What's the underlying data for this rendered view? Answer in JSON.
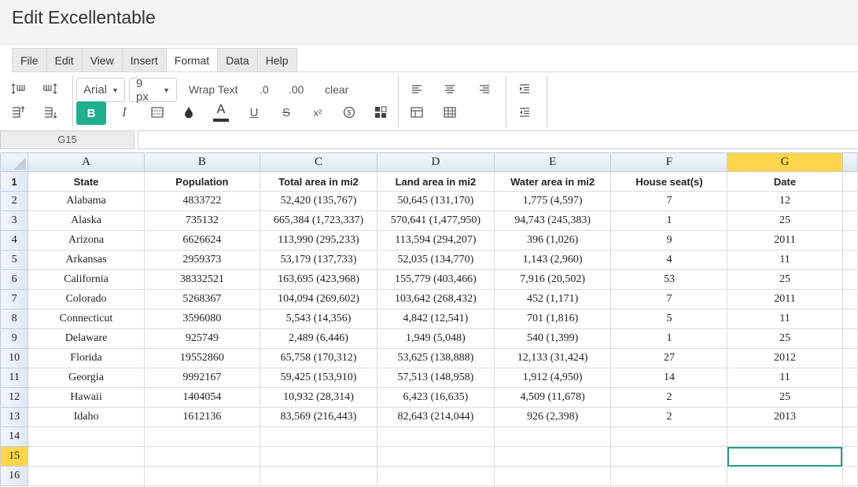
{
  "app": {
    "title": "Edit Excellentable"
  },
  "menu": [
    {
      "label": "File"
    },
    {
      "label": "Edit"
    },
    {
      "label": "View"
    },
    {
      "label": "Insert"
    },
    {
      "label": "Format",
      "active": true
    },
    {
      "label": "Data"
    },
    {
      "label": "Help"
    }
  ],
  "toolbar": {
    "font_family": "Arial",
    "font_size": "9 px",
    "wrap_text_label": "Wrap Text",
    "decimal_decrease_label": ".0",
    "decimal_increase_label": ".00",
    "clear_label": "clear",
    "bold_label": "B",
    "italic_label": "I",
    "underline_label": "U",
    "strike_label": "S",
    "superscript_label": "x²",
    "font_color_label": "A",
    "accent_color": "#21b08f"
  },
  "formula_bar": {
    "cell_ref": "G15",
    "value": ""
  },
  "sheet": {
    "columns": [
      "A",
      "B",
      "C",
      "D",
      "E",
      "F",
      "G"
    ],
    "selected_column": "G",
    "selected_row": 15,
    "header_row": [
      "State",
      "Population",
      "Total area in mi2",
      "Land area in mi2",
      "Water area in mi2",
      "House seat(s)",
      "Date"
    ],
    "rows": [
      [
        "Alabama",
        "4833722",
        "52,420 (135,767)",
        "50,645 (131,170)",
        "1,775 (4,597)",
        "7",
        "12"
      ],
      [
        "Alaska",
        "735132",
        "665,384 (1,723,337)",
        "570,641 (1,477,950)",
        "94,743 (245,383)",
        "1",
        "25"
      ],
      [
        "Arizona",
        "6626624",
        "113,990 (295,233)",
        "113,594 (294,207)",
        "396 (1,026)",
        "9",
        "2011"
      ],
      [
        "Arkansas",
        "2959373",
        "53,179 (137,733)",
        "52,035 (134,770)",
        "1,143 (2,960)",
        "4",
        "11"
      ],
      [
        "California",
        "38332521",
        "163,695 (423,968)",
        "155,779 (403,466)",
        "7,916 (20,502)",
        "53",
        "25"
      ],
      [
        "Colorado",
        "5268367",
        "104,094 (269,602)",
        "103,642 (268,432)",
        "452 (1,171)",
        "7",
        "2011"
      ],
      [
        "Connecticut",
        "3596080",
        "5,543 (14,356)",
        "4,842 (12,541)",
        "701 (1,816)",
        "5",
        "11"
      ],
      [
        "Delaware",
        "925749",
        "2,489 (6,446)",
        "1,949 (5,048)",
        "540 (1,399)",
        "1",
        "25"
      ],
      [
        "Florida",
        "19552860",
        "65,758 (170,312)",
        "53,625 (138,888)",
        "12,133 (31,424)",
        "27",
        "2012"
      ],
      [
        "Georgia",
        "9992167",
        "59,425 (153,910)",
        "57,513 (148,958)",
        "1,912 (4,950)",
        "14",
        "11"
      ],
      [
        "Hawaii",
        "1404054",
        "10,932 (28,314)",
        "6,423 (16,635)",
        "4,509 (11,678)",
        "2",
        "25"
      ],
      [
        "Idaho",
        "1612136",
        "83,569 (216,443)",
        "82,643 (214,044)",
        "926 (2,398)",
        "2",
        "2013"
      ],
      [
        "",
        "",
        "",
        "",
        "",
        "",
        ""
      ],
      [
        "",
        "",
        "",
        "",
        "",
        "",
        ""
      ],
      [
        "",
        "",
        "",
        "",
        "",
        "",
        ""
      ]
    ]
  }
}
